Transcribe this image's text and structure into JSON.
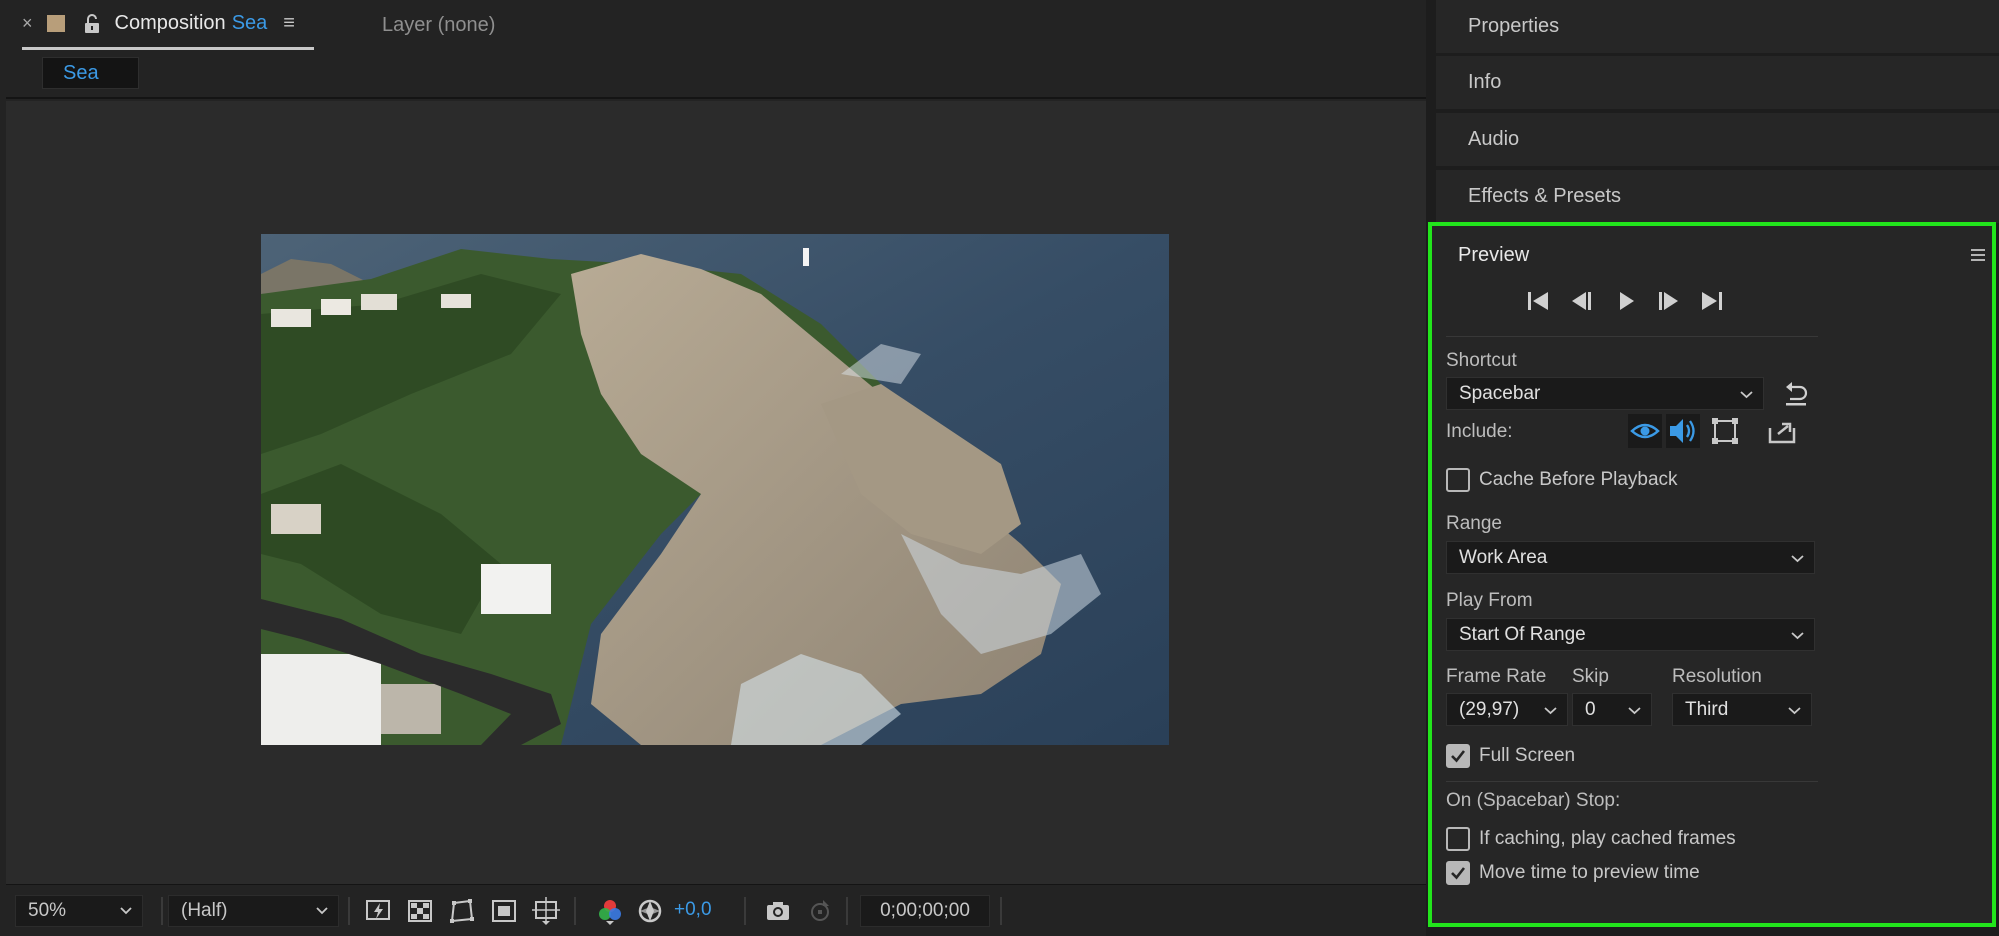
{
  "viewer": {
    "comp_tab": {
      "close": "×",
      "title": "Composition",
      "name": "Sea",
      "menu": "≡"
    },
    "layer_tab": {
      "label": "Layer (none)"
    },
    "composition_chip": "Sea",
    "bottom": {
      "zoom": "50%",
      "resolution": "(Half)",
      "exposure": "+0,0",
      "timecode": "0;00;00;00"
    }
  },
  "panels": {
    "properties": "Properties",
    "info": "Info",
    "audio": "Audio",
    "effects": "Effects & Presets"
  },
  "preview": {
    "title": "Preview",
    "shortcut_label": "Shortcut",
    "shortcut_value": "Spacebar",
    "include_label": "Include:",
    "cache_before_playback": {
      "label": "Cache Before Playback",
      "checked": false
    },
    "range_label": "Range",
    "range_value": "Work Area",
    "play_from_label": "Play From",
    "play_from_value": "Start Of Range",
    "frame_rate_label": "Frame Rate",
    "frame_rate_value": "(29,97)",
    "skip_label": "Skip",
    "skip_value": "0",
    "resolution_label": "Resolution",
    "resolution_value": "Third",
    "full_screen": {
      "label": "Full Screen",
      "checked": true
    },
    "on_stop_label": "On (Spacebar) Stop:",
    "if_caching": {
      "label": "If caching, play cached frames",
      "checked": false
    },
    "move_time": {
      "label": "Move time to preview time",
      "checked": true
    }
  },
  "colors": {
    "accent_blue": "#3b9ae6",
    "highlight_green": "#22e51c",
    "panel_bg": "#262626",
    "viewer_bg": "#2b2b2b"
  }
}
